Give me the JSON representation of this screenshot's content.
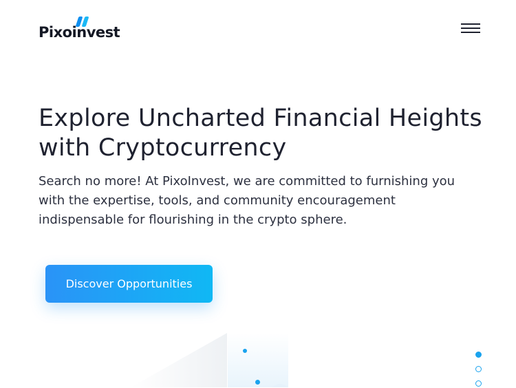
{
  "header": {
    "logo_text": "Pixoinvest",
    "menu_icon": "hamburger-menu-icon"
  },
  "hero": {
    "title_line1": "Explore Uncharted Financial Heights",
    "title_line2": "with Cryptocurrency",
    "description": "Search no more! At PixoInvest, we are committed to furnishing you with the expertise, tools, and community encouragement indispensable for flourishing in the crypto sphere.",
    "cta_label": "Discover Opportunities"
  },
  "pager": {
    "count": 3,
    "active_index": 0
  },
  "colors": {
    "accent": "#1aa3ee",
    "button_start": "#2a93f7",
    "button_end": "#10b8f4",
    "text": "#1f2230"
  }
}
